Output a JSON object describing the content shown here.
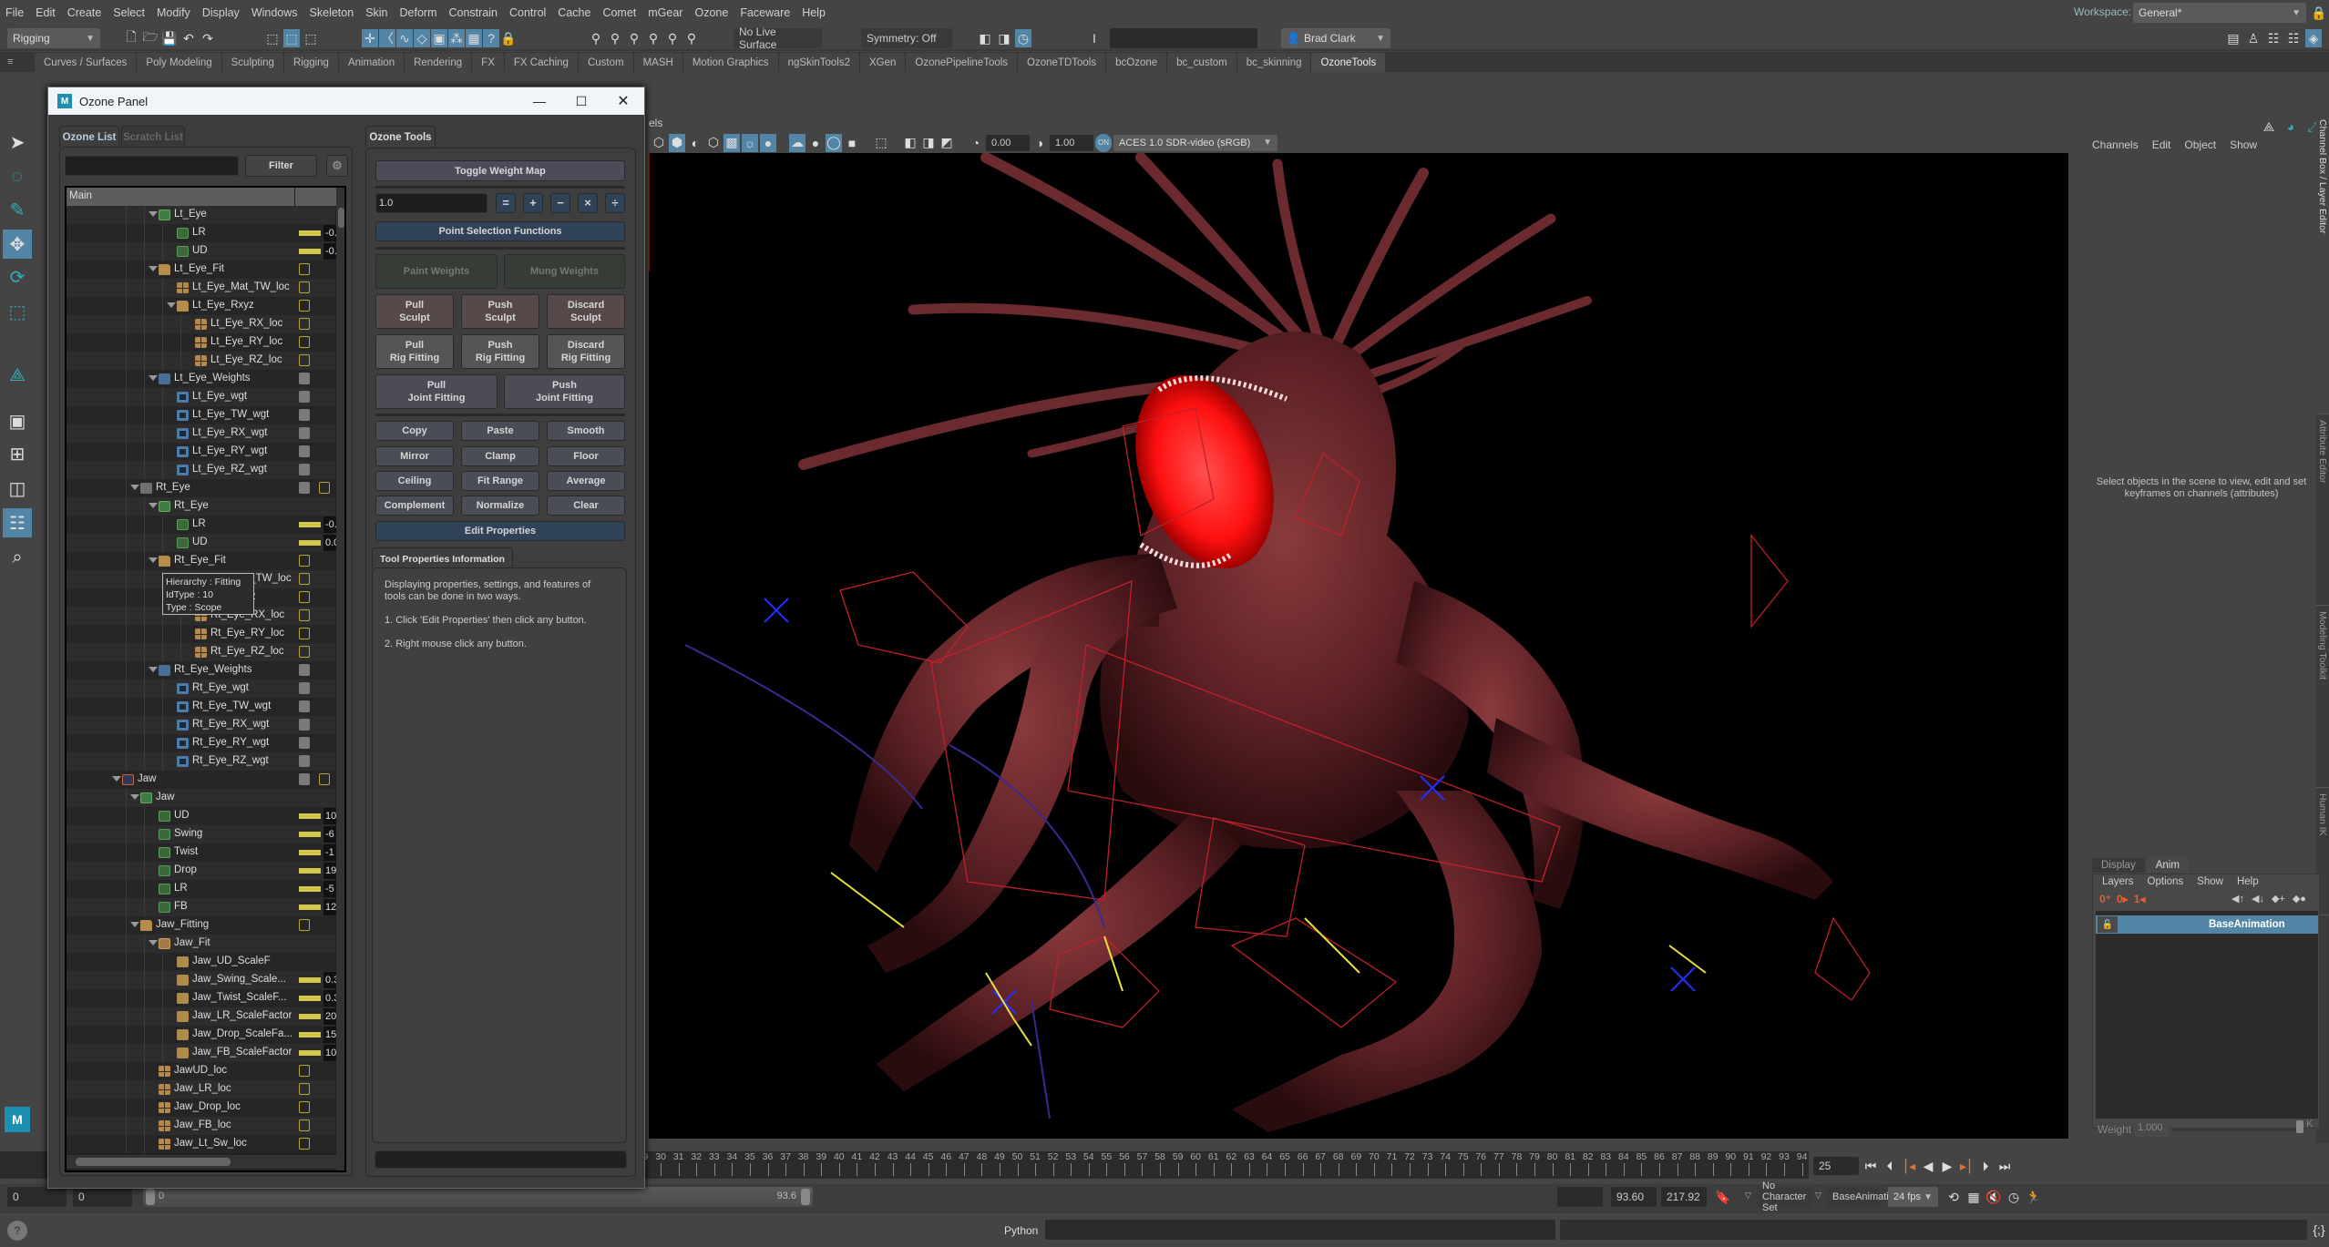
{
  "menubar": [
    "File",
    "Edit",
    "Create",
    "Select",
    "Modify",
    "Display",
    "Windows",
    "Skeleton",
    "Skin",
    "Deform",
    "Constrain",
    "Control",
    "Cache",
    "Comet",
    "mGear",
    "Ozone",
    "Faceware",
    "Help"
  ],
  "statusline": {
    "mode": "Rigging",
    "live_surface": "No Live Surface",
    "symmetry": "Symmetry: Off",
    "user": "Brad Clark",
    "workspace_label": "Workspace:",
    "workspace": "General*"
  },
  "shelf_tabs": [
    "Curves / Surfaces",
    "Poly Modeling",
    "Sculpting",
    "Rigging",
    "Animation",
    "Rendering",
    "FX",
    "FX Caching",
    "Custom",
    "MASH",
    "Motion Graphics",
    "ngSkinTools2",
    "XGen",
    "OzonePipelineTools",
    "OzoneTDTools",
    "bcOzone",
    "bc_custom",
    "bc_skinning",
    "OzoneTools"
  ],
  "shelf_active": "OzoneTools",
  "viewport": {
    "panels_menu": "els",
    "exposure": "0.00",
    "gamma": "1.00",
    "color_space": "ACES 1.0 SDR-video (sRGB)",
    "accent": "#5285a6"
  },
  "channel_box": {
    "menu": [
      "Channels",
      "Edit",
      "Object",
      "Show"
    ],
    "message": "Select objects in the scene to view, edit and set keyframes on channels (attributes)"
  },
  "side_tabs": [
    "Channel Box / Layer Editor",
    "Attribute Editor",
    "Modeling Toolkit",
    "Human IK"
  ],
  "layer_editor": {
    "tabs": [
      "Display",
      "Anim"
    ],
    "active_tab": "Anim",
    "menu": [
      "Layers",
      "Options",
      "Show",
      "Help"
    ],
    "layer": "BaseAnimation",
    "weight_label": "Weight",
    "weight_value": "1.000",
    "key_label": "K"
  },
  "ozone_panel": {
    "title": "Ozone Panel",
    "list_tabs": [
      "Ozone List",
      "Scratch List"
    ],
    "filter_value": "",
    "filter_button": "Filter",
    "tree_header": "Main",
    "tree_rows": [
      {
        "d": 3,
        "label": "Lt_Eye",
        "icon": "ctrl-green",
        "exp": true
      },
      {
        "d": 4,
        "label": "LR",
        "icon": "curve-green",
        "ind": "bar",
        "val": "-0."
      },
      {
        "d": 4,
        "label": "UD",
        "icon": "curve-green",
        "ind": "bar",
        "val": "-0."
      },
      {
        "d": 3,
        "label": "Lt_Eye_Fit",
        "icon": "folder-tan",
        "exp": true,
        "ind": "box"
      },
      {
        "d": 4,
        "label": "Lt_Eye_Mat_TW_loc",
        "icon": "loc",
        "ind": "box"
      },
      {
        "d": 4,
        "label": "Lt_Eye_Rxyz",
        "icon": "folder-tan",
        "exp": true,
        "ind": "box"
      },
      {
        "d": 5,
        "label": "Lt_Eye_RX_loc",
        "icon": "loc",
        "ind": "box"
      },
      {
        "d": 5,
        "label": "Lt_Eye_RY_loc",
        "icon": "loc",
        "ind": "box"
      },
      {
        "d": 5,
        "label": "Lt_Eye_RZ_loc",
        "icon": "loc",
        "ind": "box"
      },
      {
        "d": 3,
        "label": "Lt_Eye_Weights",
        "icon": "folder-blue",
        "exp": true,
        "ind": "gray"
      },
      {
        "d": 4,
        "label": "Lt_Eye_wgt",
        "icon": "wgt",
        "ind": "gray"
      },
      {
        "d": 4,
        "label": "Lt_Eye_TW_wgt",
        "icon": "wgt",
        "ind": "gray"
      },
      {
        "d": 4,
        "label": "Lt_Eye_RX_wgt",
        "icon": "wgt",
        "ind": "gray"
      },
      {
        "d": 4,
        "label": "Lt_Eye_RY_wgt",
        "icon": "wgt",
        "ind": "gray"
      },
      {
        "d": 4,
        "label": "Lt_Eye_RZ_wgt",
        "icon": "wgt",
        "ind": "gray"
      },
      {
        "d": 2,
        "label": "Rt_Eye",
        "icon": "folder-gray",
        "exp": true,
        "ind": "gray-box"
      },
      {
        "d": 3,
        "label": "Rt_Eye",
        "icon": "ctrl-green",
        "exp": true
      },
      {
        "d": 4,
        "label": "LR",
        "icon": "curve-green",
        "ind": "bar",
        "val": "-0."
      },
      {
        "d": 4,
        "label": "UD",
        "icon": "curve-green",
        "ind": "bar",
        "val": "0.0"
      },
      {
        "d": 3,
        "label": "Rt_Eye_Fit",
        "icon": "folder-tan",
        "exp": true,
        "ind": "box"
      },
      {
        "d": 4,
        "label": "Rt_Eye_Mat_TW_loc",
        "icon": "loc",
        "ind": "box"
      },
      {
        "d": 4,
        "label": "Rt_Eye_Rxyz",
        "icon": "folder-tan",
        "exp": true,
        "ind": "box"
      },
      {
        "d": 5,
        "label": "Rt_Eye_RX_loc",
        "icon": "loc",
        "ind": "box"
      },
      {
        "d": 5,
        "label": "Rt_Eye_RY_loc",
        "icon": "loc",
        "ind": "box"
      },
      {
        "d": 5,
        "label": "Rt_Eye_RZ_loc",
        "icon": "loc",
        "ind": "box"
      },
      {
        "d": 3,
        "label": "Rt_Eye_Weights",
        "icon": "folder-blue",
        "exp": true,
        "ind": "gray"
      },
      {
        "d": 4,
        "label": "Rt_Eye_wgt",
        "icon": "wgt",
        "ind": "gray"
      },
      {
        "d": 4,
        "label": "Rt_Eye_TW_wgt",
        "icon": "wgt",
        "ind": "gray"
      },
      {
        "d": 4,
        "label": "Rt_Eye_RX_wgt",
        "icon": "wgt",
        "ind": "gray"
      },
      {
        "d": 4,
        "label": "Rt_Eye_RY_wgt",
        "icon": "wgt",
        "ind": "gray"
      },
      {
        "d": 4,
        "label": "Rt_Eye_RZ_wgt",
        "icon": "wgt",
        "ind": "gray"
      },
      {
        "d": 1,
        "label": "Jaw",
        "icon": "group-red",
        "exp": true,
        "ind": "gray-box"
      },
      {
        "d": 2,
        "label": "Jaw",
        "icon": "ctrl-green",
        "exp": true
      },
      {
        "d": 3,
        "label": "UD",
        "icon": "curve-green",
        "ind": "bar",
        "val": "10"
      },
      {
        "d": 3,
        "label": "Swing",
        "icon": "curve-green",
        "ind": "bar",
        "val": "-6"
      },
      {
        "d": 3,
        "label": "Twist",
        "icon": "curve-green",
        "ind": "bar",
        "val": "-1"
      },
      {
        "d": 3,
        "label": "Drop",
        "icon": "curve-green",
        "ind": "bar",
        "val": "19"
      },
      {
        "d": 3,
        "label": "LR",
        "icon": "curve-green",
        "ind": "bar",
        "val": "-5"
      },
      {
        "d": 3,
        "label": "FB",
        "icon": "curve-green",
        "ind": "bar",
        "val": "12"
      },
      {
        "d": 2,
        "label": "Jaw_Fitting",
        "icon": "folder-tan",
        "exp": true,
        "ind": "box"
      },
      {
        "d": 3,
        "label": "Jaw_Fit",
        "icon": "ctrl-tan",
        "exp": true
      },
      {
        "d": 4,
        "label": "Jaw_UD_ScaleF",
        "icon": "curve-tan"
      },
      {
        "d": 4,
        "label": "Jaw_Swing_Scale...",
        "icon": "curve-tan",
        "ind": "bar",
        "val": "0.3"
      },
      {
        "d": 4,
        "label": "Jaw_Twist_ScaleF...",
        "icon": "curve-tan",
        "ind": "bar",
        "val": "0.3"
      },
      {
        "d": 4,
        "label": "Jaw_LR_ScaleFactor",
        "icon": "curve-tan",
        "ind": "bar",
        "val": "20"
      },
      {
        "d": 4,
        "label": "Jaw_Drop_ScaleFa...",
        "icon": "curve-tan",
        "ind": "bar",
        "val": "15"
      },
      {
        "d": 4,
        "label": "Jaw_FB_ScaleFactor",
        "icon": "curve-tan",
        "ind": "bar",
        "val": "10"
      },
      {
        "d": 3,
        "label": "JawUD_loc",
        "icon": "loc",
        "ind": "box"
      },
      {
        "d": 3,
        "label": "Jaw_LR_loc",
        "icon": "loc",
        "ind": "box"
      },
      {
        "d": 3,
        "label": "Jaw_Drop_loc",
        "icon": "loc",
        "ind": "box"
      },
      {
        "d": 3,
        "label": "Jaw_FB_loc",
        "icon": "loc",
        "ind": "box"
      },
      {
        "d": 3,
        "label": "Jaw_Lt_Sw_loc",
        "icon": "loc",
        "ind": "box"
      }
    ],
    "tooltip": [
      "Hierarchy : Fitting",
      "IdType : 10",
      "Type : Scope"
    ],
    "tools_tab": "Ozone Tools",
    "toggle_weight_map": "Toggle Weight Map",
    "value_input": "1.0",
    "operators": [
      "=",
      "+",
      "−",
      "×",
      "÷"
    ],
    "point_selection": "Point Selection Functions",
    "paint_weights": "Paint Weights",
    "mung_weights": "Mung Weights",
    "sculpt_buttons": [
      "Pull\nSculpt",
      "Push\nSculpt",
      "Discard\nSculpt"
    ],
    "rig_buttons": [
      "Pull\nRig Fitting",
      "Push\nRig Fitting",
      "Discard\nRig Fitting"
    ],
    "joint_buttons": [
      "Pull\nJoint Fitting",
      "Push\nJoint Fitting"
    ],
    "op_buttons": [
      "Copy",
      "Paste",
      "Smooth",
      "Mirror",
      "Clamp",
      "Floor",
      "Ceiling",
      "Fit Range",
      "Average",
      "Complement",
      "Normalize",
      "Clear"
    ],
    "edit_properties": "Edit Properties",
    "info_tab": "Tool Properties Information",
    "info_text": [
      "Displaying properties, settings, and features of tools can be done in two ways.",
      "1. Click 'Edit Properties' then click any button.",
      "2. Right mouse click any button."
    ]
  },
  "timeline": {
    "frames_start": 0,
    "frames_end": 94,
    "current_frame": "25"
  },
  "range_slider": {
    "start": "0",
    "inner_start": "0",
    "bar_start": "0",
    "bar_end": "93.6",
    "inner_end": "93.60",
    "end": "217.92",
    "character_set": "No Character Set",
    "anim_layer": "BaseAnimation",
    "fps": "24 fps"
  },
  "command_line": {
    "language": "Python"
  }
}
